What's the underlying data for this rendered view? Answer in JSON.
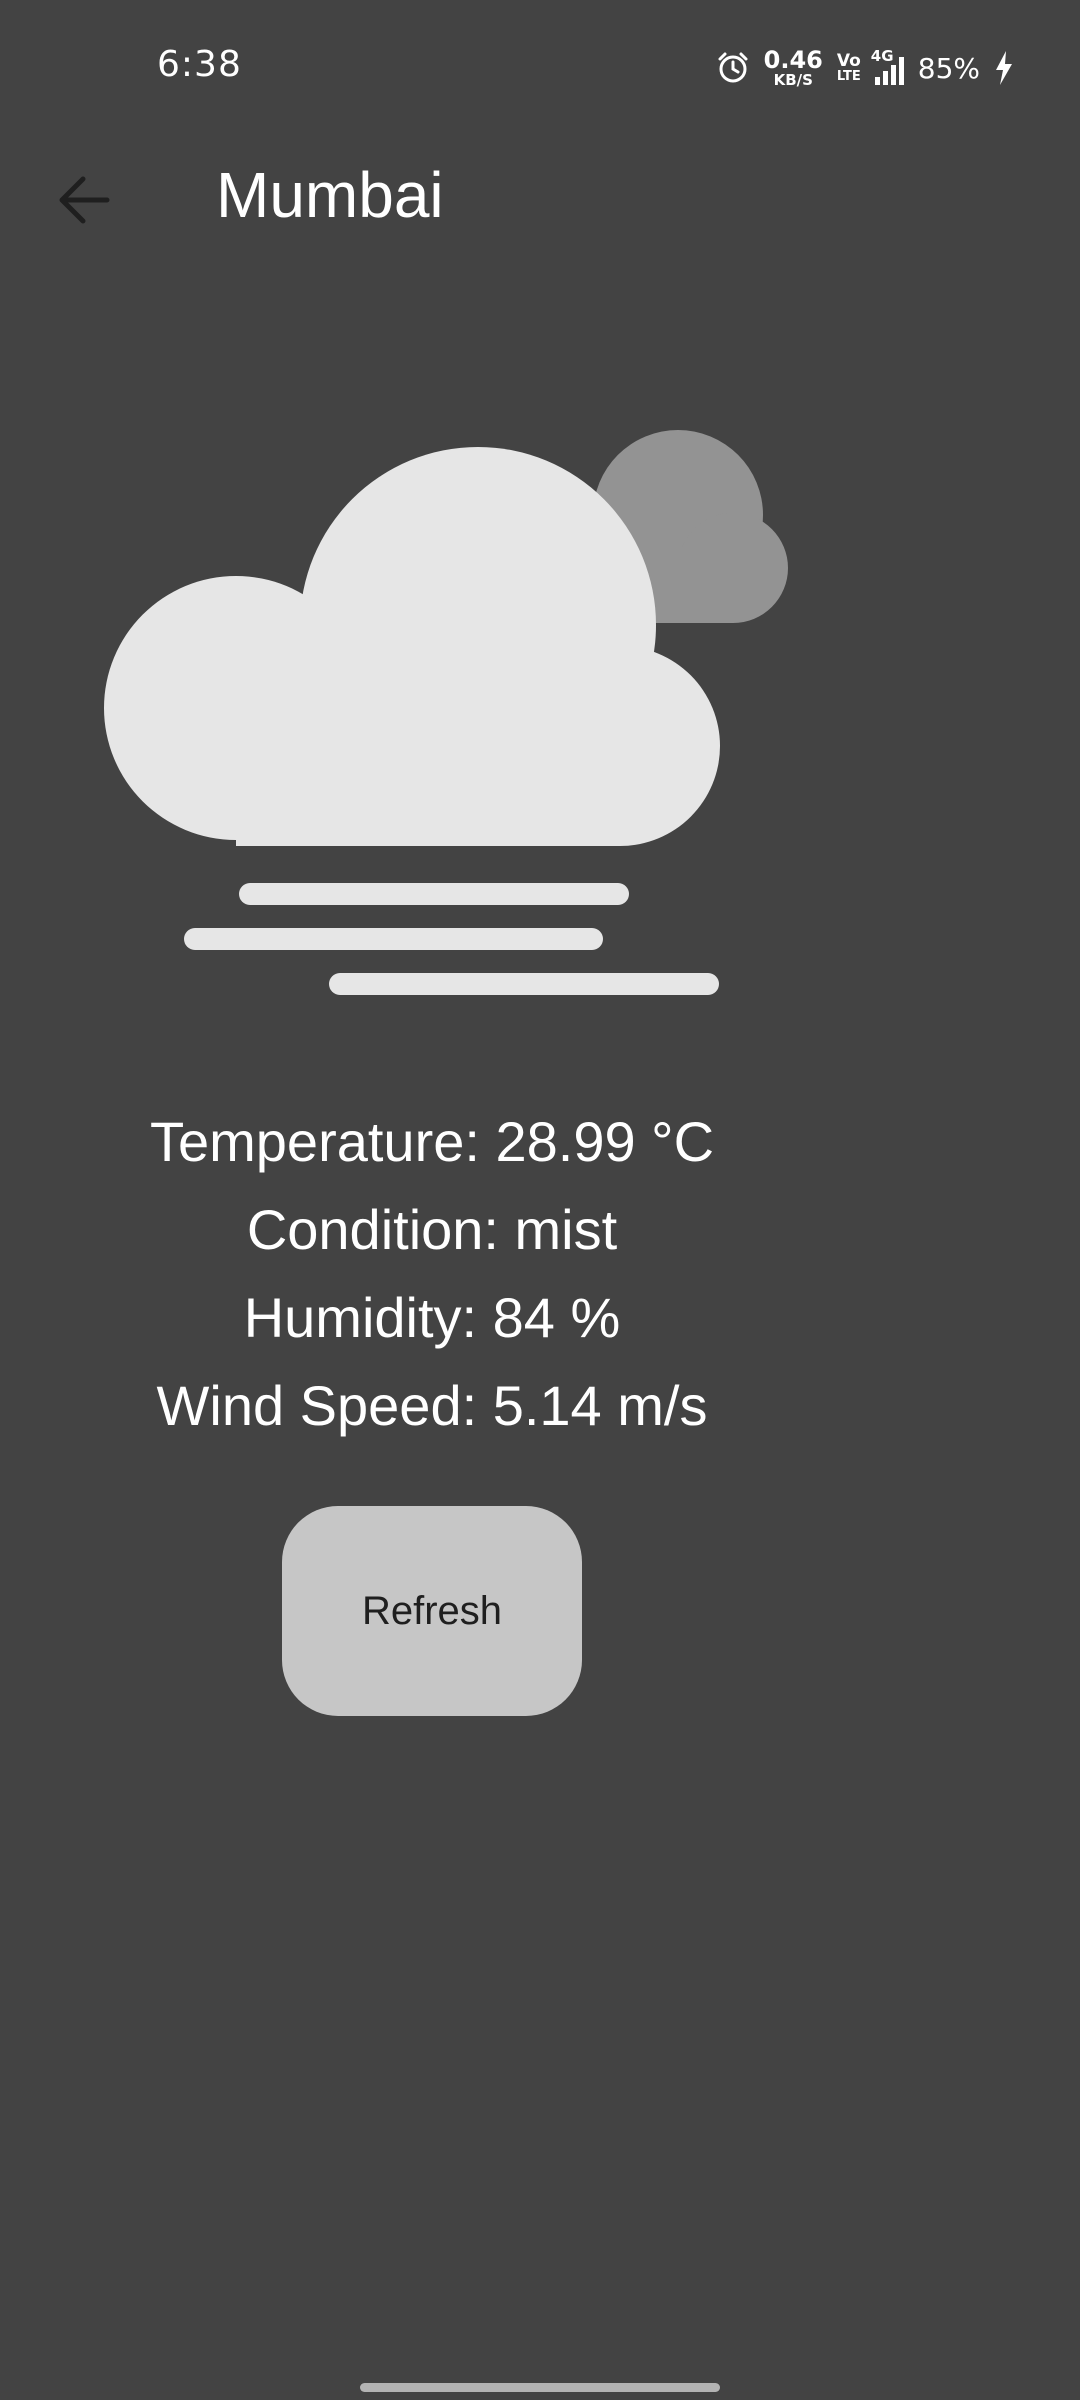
{
  "status_bar": {
    "time": "6:38",
    "net_speed_value": "0.46",
    "net_speed_unit": "KB/S",
    "volte_top": "Vo",
    "volte_bottom": "LTE",
    "network_type": "4G",
    "battery_percent": "85%",
    "icons": [
      "alarm-icon",
      "cellular-signal-icon",
      "charging-bolt-icon"
    ]
  },
  "app_bar": {
    "title": "Mumbai",
    "back_icon": "arrow-left-icon"
  },
  "weather": {
    "icon": "cloud-fog-icon",
    "lines": [
      "Temperature: 28.99 °C",
      "Condition: mist",
      "Humidity: 84 %",
      "Wind Speed: 5.14 m/s"
    ]
  },
  "actions": {
    "refresh_label": "Refresh"
  },
  "colors": {
    "background": "#434343",
    "cloud_front": "#e6e6e6",
    "cloud_back": "#939393",
    "button": "#c6c6c6",
    "text": "#ffffff"
  }
}
